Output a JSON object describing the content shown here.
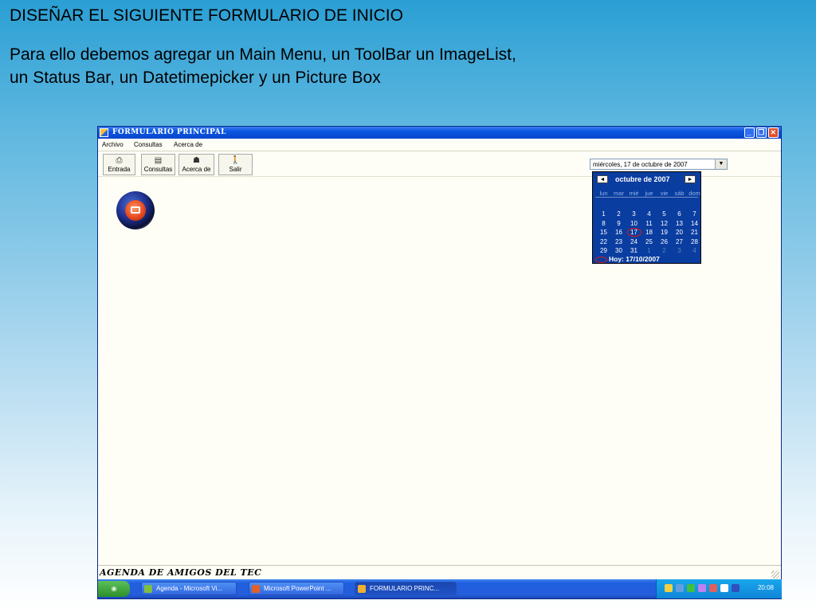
{
  "slide": {
    "title": "DISEÑAR EL SIGUIENTE FORMULARIO DE INICIO",
    "body": "Para ello debemos agregar un Main Menu, un ToolBar un ImageList, un Status Bar, un Datetimepicker y un Picture Box"
  },
  "window": {
    "title": "FORMULARIO PRINCIPAL",
    "controls": {
      "minimize": "_",
      "maximize": "❐",
      "close": "✕"
    }
  },
  "menubar": {
    "items": [
      "Archivo",
      "Consultas",
      "Acerca de"
    ]
  },
  "toolbar": {
    "buttons": [
      {
        "label": "Entrada",
        "icon": "login-icon"
      },
      {
        "label": "Consultas",
        "icon": "query-icon"
      },
      {
        "label": "Acerca de",
        "icon": "graduation-cap-icon"
      },
      {
        "label": "Salir",
        "icon": "exit-person-icon"
      }
    ]
  },
  "datetimepicker": {
    "value": "miércoles, 17 de   octubre   de 2007",
    "drop_glyph": "▼"
  },
  "calendar": {
    "month_label": "octubre de 2007",
    "prev_glyph": "◄",
    "next_glyph": "►",
    "weekdays": [
      "lun",
      "mar",
      "mié",
      "jue",
      "vie",
      "sáb",
      "dom"
    ],
    "weeks": [
      [
        "1",
        "2",
        "3",
        "4",
        "5",
        "6",
        "7"
      ],
      [
        "8",
        "9",
        "10",
        "11",
        "12",
        "13",
        "14"
      ],
      [
        "15",
        "16",
        "17",
        "18",
        "19",
        "20",
        "21"
      ],
      [
        "22",
        "23",
        "24",
        "25",
        "26",
        "27",
        "28"
      ],
      [
        "29",
        "30",
        "31",
        "1",
        "2",
        "3",
        "4"
      ]
    ],
    "selected_day": "17",
    "today_label": "Hoy: 17/10/2007"
  },
  "statusbar": {
    "text": "AGENDA DE AMIGOS DEL TEC"
  },
  "taskbar": {
    "items": [
      {
        "label": "Agenda - Microsoft Vi...",
        "color": "#7fbf3f"
      },
      {
        "label": "Microsoft PowerPoint ...",
        "color": "#e0602a"
      },
      {
        "label": "FORMULARIO PRINC...",
        "color": "#f0b030"
      }
    ],
    "clock": "20:08"
  },
  "colors": {
    "titlebar": "#0a56e0",
    "calendar_bg": "#0a3da0",
    "window_bg": "#fefef6",
    "highlight_circle": "#e01818"
  }
}
